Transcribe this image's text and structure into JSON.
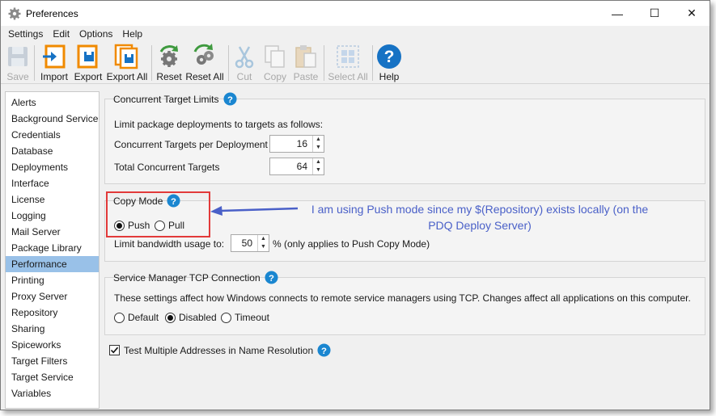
{
  "window": {
    "title": "Preferences",
    "controls": {
      "minimize": "—",
      "maximize": "☐",
      "close": "✕"
    }
  },
  "menu": [
    "Settings",
    "Edit",
    "Options",
    "Help"
  ],
  "toolbar": {
    "save": "Save",
    "import": "Import",
    "export": "Export",
    "export_all": "Export All",
    "reset": "Reset",
    "reset_all": "Reset All",
    "cut": "Cut",
    "copy": "Copy",
    "paste": "Paste",
    "select_all": "Select All",
    "help": "Help"
  },
  "sidebar": {
    "items": [
      "Alerts",
      "Background Service",
      "Credentials",
      "Database",
      "Deployments",
      "Interface",
      "License",
      "Logging",
      "Mail Server",
      "Package Library",
      "Performance",
      "Printing",
      "Proxy Server",
      "Repository",
      "Sharing",
      "Spiceworks",
      "Target Filters",
      "Target Service",
      "Variables"
    ],
    "selected": "Performance"
  },
  "concurrent": {
    "title": "Concurrent Target Limits",
    "description": "Limit package deployments to targets as follows:",
    "per_deployment_label": "Concurrent Targets per Deployment",
    "per_deployment_value": "16",
    "total_label": "Total Concurrent Targets",
    "total_value": "64"
  },
  "copy_mode": {
    "title": "Copy Mode",
    "push_label": "Push",
    "pull_label": "Pull",
    "selected": "Push",
    "bandwidth_label": "Limit bandwidth usage to:",
    "bandwidth_value": "50",
    "bandwidth_suffix": "% (only applies to Push Copy Mode)"
  },
  "tcp": {
    "title": "Service Manager TCP Connection",
    "description": "These settings affect how Windows connects to remote service managers using TCP. Changes affect all applications on this computer.",
    "options": [
      "Default",
      "Disabled",
      "Timeout"
    ],
    "selected": "Disabled"
  },
  "test_multiple": {
    "label": "Test Multiple Addresses in Name Resolution",
    "checked": true
  },
  "annotation": {
    "line1": "I am using Push mode since my $(Repository) exists locally (on the",
    "line2": "PDQ Deploy Server)"
  },
  "colors": {
    "selection": "#99c1e8",
    "help_blue": "#1a86d0",
    "annotation_blue": "#4a60c8",
    "annotation_box": "#e23a3a"
  }
}
